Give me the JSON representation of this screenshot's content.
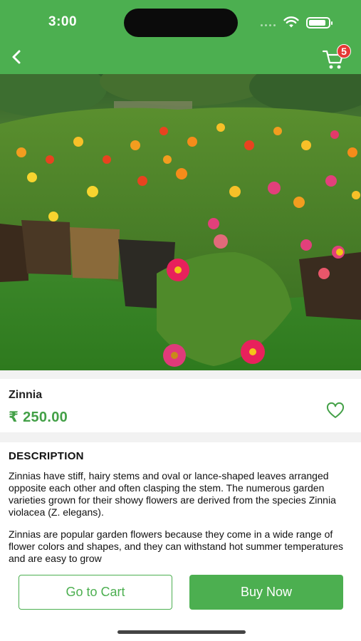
{
  "status_bar": {
    "time": "3:00",
    "battery_level": 0.9
  },
  "header": {
    "back_icon": "chevron-left-icon",
    "cart_icon": "cart-icon",
    "cart_count": "5",
    "background_color": "#4caf50"
  },
  "product": {
    "name": "Zinnia",
    "price": "₹ 250.00",
    "favorite_icon": "heart-icon",
    "image_subject": "potted zinnia flowers"
  },
  "description": {
    "heading": "DESCRIPTION",
    "paragraphs": [
      "Zinnias have stiff, hairy stems and oval or lance-shaped leaves arranged opposite each other and often clasping the stem. The numerous garden varieties grown for their showy flowers are derived from the species Zinnia violacea (Z. elegans).",
      "Zinnias are popular garden flowers because they come in a wide range of flower colors and shapes, and they can withstand hot summer temperatures and are easy to grow"
    ]
  },
  "actions": {
    "go_to_cart": "Go to Cart",
    "buy_now": "Buy Now"
  },
  "colors": {
    "accent": "#4caf50",
    "price": "#43a047",
    "badge": "#e53935"
  }
}
